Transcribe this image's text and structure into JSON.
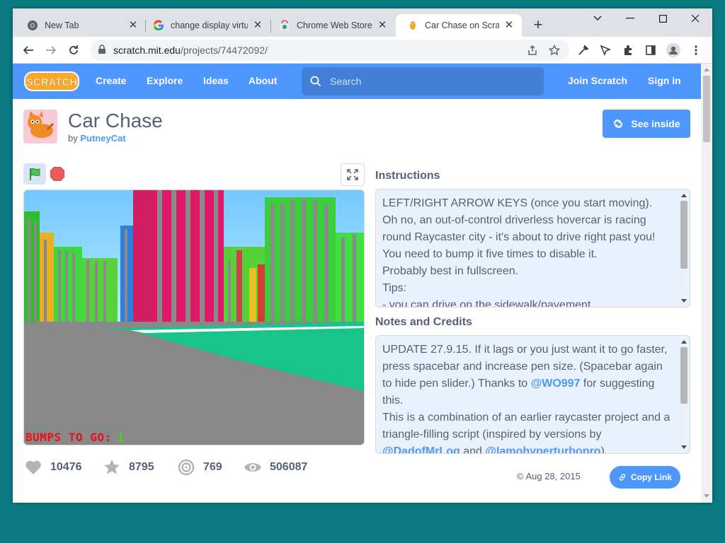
{
  "browser": {
    "tabs": [
      {
        "title": "New Tab"
      },
      {
        "title": "change display virtua"
      },
      {
        "title": "Chrome Web Store -"
      },
      {
        "title": "Car Chase on Scratch"
      }
    ],
    "url_host": "scratch.mit.edu",
    "url_path": "/projects/74472092/"
  },
  "navbar": {
    "logo": "SCRATCH",
    "links": [
      "Create",
      "Explore",
      "Ideas",
      "About"
    ],
    "search_placeholder": "Search",
    "join": "Join Scratch",
    "signin": "Sign in"
  },
  "project": {
    "title": "Car Chase",
    "by": "by",
    "author": "PutneyCat",
    "see_inside": "See inside",
    "stage_text": "BUMPS TO GO:",
    "stage_count": "1"
  },
  "instructions": {
    "heading": "Instructions",
    "lines": [
      "LEFT/RIGHT ARROW KEYS (once you start moving).",
      "Oh no, an out-of-control driverless hovercar is racing",
      "round Raycaster city - it's about to drive right past you!",
      "You need to bump it five times to disable it.",
      "Probably best in fullscreen.",
      "Tips:",
      "- you can drive on the sidewalk/pavement"
    ]
  },
  "notes": {
    "heading": "Notes and Credits",
    "line1": "UPDATE 27.9.15. If it lags or you just want it to go faster,",
    "line2": "press spacebar and increase pen size. (Spacebar again",
    "line3_pre": "to hide pen slider.) Thanks to ",
    "line3_mention": "@WO997",
    "line3_post": " for suggesting",
    "line4": "this.",
    "line5": "This is a combination of an earlier raycaster project and a",
    "line6": "triangle-filling script (inspired by versions by",
    "line7_mention1": "@DadofMrLog",
    "line7_mid": " and ",
    "line7_mention2": "@Iamohyperturbopro",
    "line7_post": ")"
  },
  "stats": {
    "loves": "10476",
    "favorites": "8795",
    "remixes": "769",
    "views": "506087"
  },
  "date": "Aug 28, 2015",
  "copy_link": "Copy Link",
  "colors": {
    "scratch_blue": "#4d97ff",
    "text": "#575e75",
    "desktop": "#0b7b82"
  },
  "icons": [
    "chrome-icon",
    "google-icon",
    "webstore-icon",
    "scratch-cat-icon",
    "lock-icon",
    "share-icon",
    "star-icon",
    "eyedropper-icon",
    "cursor-icon",
    "puzzle-icon",
    "sidepanel-icon",
    "profile-icon",
    "kebab-icon",
    "search-icon",
    "green-flag-icon",
    "stop-icon",
    "fullscreen-icon",
    "heart-icon",
    "remix-icon",
    "eye-icon",
    "link-icon"
  ]
}
